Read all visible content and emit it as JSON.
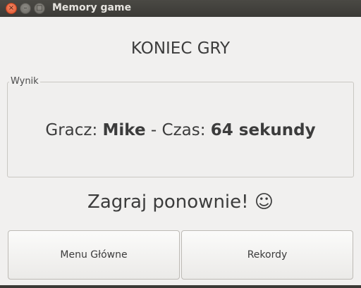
{
  "window": {
    "title": "Memory game",
    "controls": {
      "close_glyph": "×",
      "minimize_glyph": "–",
      "maximize_glyph": "□"
    }
  },
  "main": {
    "heading": "KONIEC GRY",
    "result_group": {
      "legend": "Wynik",
      "player_label": "Gracz: ",
      "player_name": "Mike",
      "separator": " - ",
      "time_label": "Czas: ",
      "time_value": "64 sekundy"
    },
    "replay_text": "Zagraj ponownie! ☺"
  },
  "buttons": {
    "main_menu": "Menu Główne",
    "records": "Rekordy"
  },
  "colors": {
    "titlebar": "#3b3a36",
    "close_button": "#e0532b",
    "background": "#f1f0ef",
    "text": "#3c3c3c"
  }
}
